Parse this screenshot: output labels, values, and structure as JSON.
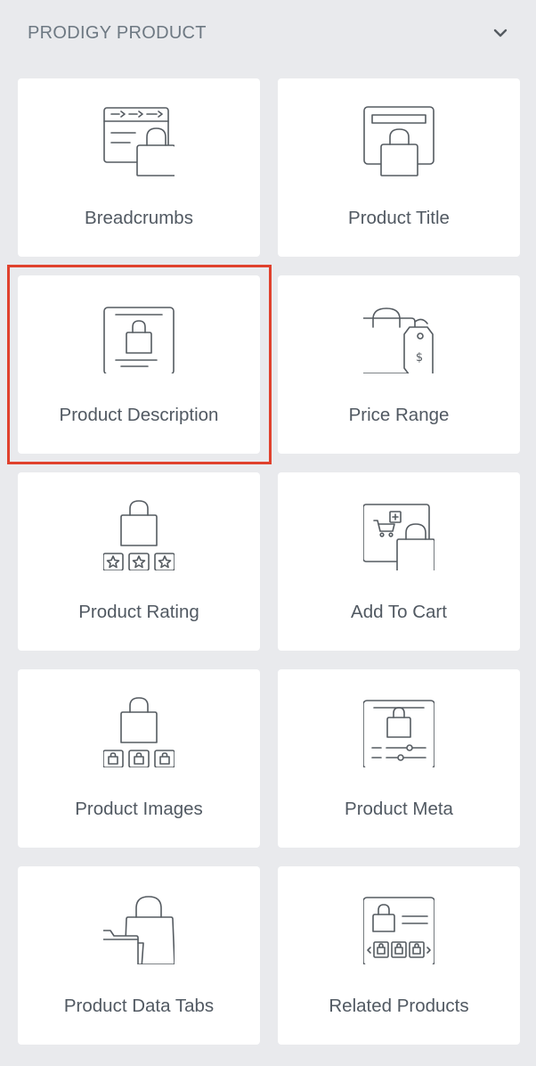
{
  "section": {
    "title": "PRODIGY PRODUCT",
    "collapse_icon": "chevron-down-icon"
  },
  "widgets": [
    {
      "label": "Breadcrumbs",
      "icon": "breadcrumbs-icon"
    },
    {
      "label": "Product Title",
      "icon": "product-title-icon"
    },
    {
      "label": "Product Description",
      "icon": "product-description-icon",
      "selected": true
    },
    {
      "label": "Price Range",
      "icon": "price-range-icon"
    },
    {
      "label": "Product Rating",
      "icon": "product-rating-icon"
    },
    {
      "label": "Add To Cart",
      "icon": "add-to-cart-icon"
    },
    {
      "label": "Product Images",
      "icon": "product-images-icon"
    },
    {
      "label": "Product Meta",
      "icon": "product-meta-icon"
    },
    {
      "label": "Product Data Tabs",
      "icon": "product-data-tabs-icon"
    },
    {
      "label": "Related Products",
      "icon": "related-products-icon"
    }
  ],
  "colors": {
    "background": "#e9eaed",
    "card": "#ffffff",
    "highlight": "#e0412d",
    "text": "#515962",
    "header_text": "#6d7882"
  }
}
